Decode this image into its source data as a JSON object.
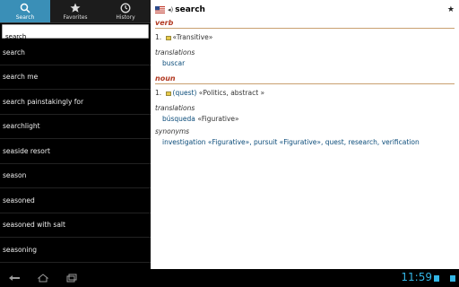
{
  "tabs": [
    {
      "label": "Search",
      "icon": "search-icon",
      "active": true
    },
    {
      "label": "Favorites",
      "icon": "star-icon",
      "active": false
    },
    {
      "label": "History",
      "icon": "clock-icon",
      "active": false
    }
  ],
  "search": {
    "value": "search",
    "placeholder": ""
  },
  "word_list": [
    "search",
    "search me",
    "search painstakingly for",
    "searchlight",
    "seaside resort",
    "season",
    "seasoned",
    "seasoned with salt",
    "seasoning"
  ],
  "entry": {
    "headword": "search",
    "speaker_icon": "speaker-icon",
    "favorite_icon": "star-icon",
    "verb": {
      "pos": "verb",
      "sense_num": "1.",
      "sense_tag": "«Transitive»",
      "translations_label": "translations",
      "translations": "buscar"
    },
    "noun": {
      "pos": "noun",
      "sense_num": "1.",
      "sense_gloss": "(quest)",
      "sense_tag": "«Politics, abstract »",
      "translations_label": "translations",
      "translation_word": "búsqueda",
      "translation_tag": "«Figurative»",
      "synonyms_label": "synonyms",
      "synonyms": "investigation «Figurative», pursuit «Figurative», quest, research, verification"
    }
  },
  "system_bar": {
    "clock": "11:59",
    "accent": "#33b5e5"
  }
}
